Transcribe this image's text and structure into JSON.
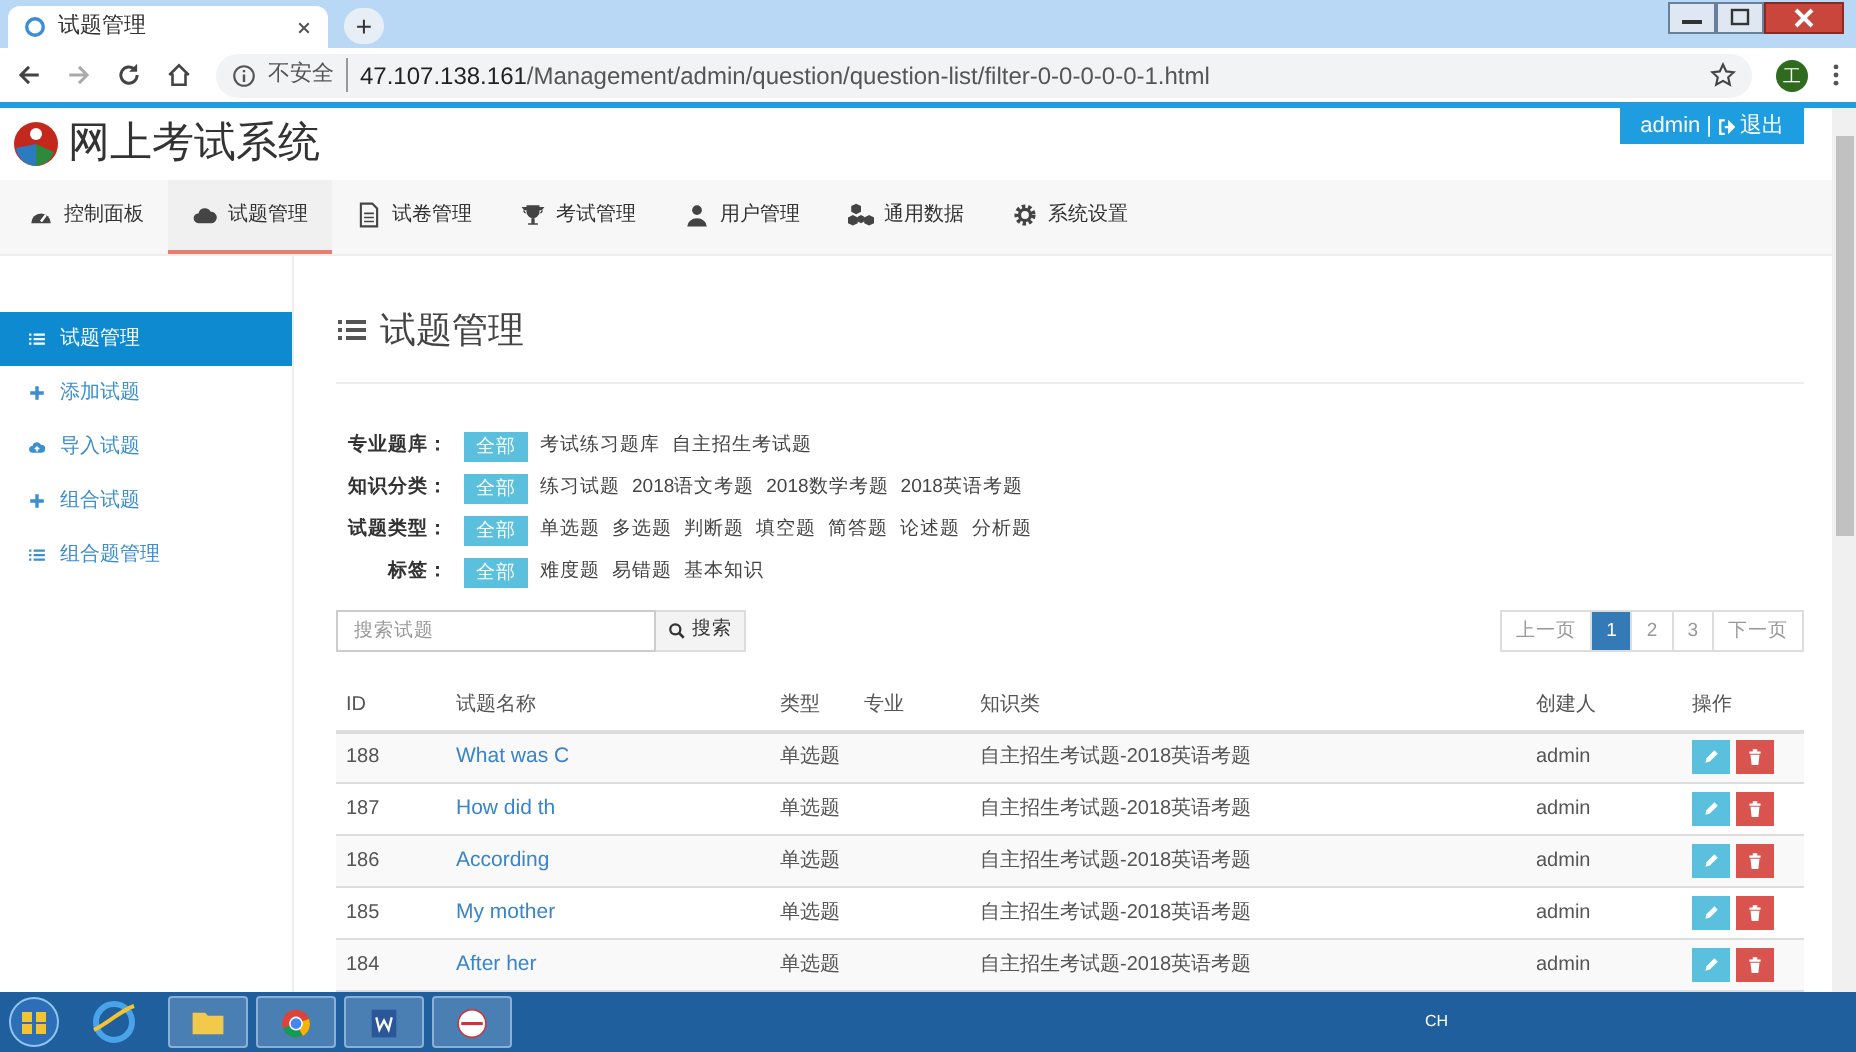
{
  "browser": {
    "tab_title": "试题管理",
    "new_tab": "+",
    "security": "不安全",
    "url_host": "47.107.138.161",
    "url_path": "/Management/admin/question/question-list/filter-0-0-0-0-0-1.html",
    "profile": "工"
  },
  "header": {
    "site_title": "网上考试系统",
    "user": "admin",
    "separator": "|",
    "logout": "退出"
  },
  "nav": [
    {
      "label": "控制面板",
      "selected": false
    },
    {
      "label": "试题管理",
      "selected": true
    },
    {
      "label": "试卷管理",
      "selected": false
    },
    {
      "label": "考试管理",
      "selected": false
    },
    {
      "label": "用户管理",
      "selected": false
    },
    {
      "label": "通用数据",
      "selected": false
    },
    {
      "label": "系统设置",
      "selected": false
    }
  ],
  "sidebar": [
    {
      "label": "试题管理",
      "selected": true
    },
    {
      "label": "添加试题",
      "selected": false
    },
    {
      "label": "导入试题",
      "selected": false
    },
    {
      "label": "组合试题",
      "selected": false
    },
    {
      "label": "组合题管理",
      "selected": false
    }
  ],
  "page_title": "试题管理",
  "filters": [
    {
      "label": "专业题库：",
      "options": [
        {
          "label": "全部",
          "selected": true
        },
        {
          "label": "考试练习题库",
          "selected": false
        },
        {
          "label": "自主招生考试题",
          "selected": false
        }
      ]
    },
    {
      "label": "知识分类：",
      "options": [
        {
          "label": "全部",
          "selected": true
        },
        {
          "label": "练习试题",
          "selected": false
        },
        {
          "label": "2018语文考题",
          "selected": false
        },
        {
          "label": "2018数学考题",
          "selected": false
        },
        {
          "label": "2018英语考题",
          "selected": false
        }
      ]
    },
    {
      "label": "试题类型：",
      "options": [
        {
          "label": "全部",
          "selected": true
        },
        {
          "label": "单选题",
          "selected": false
        },
        {
          "label": "多选题",
          "selected": false
        },
        {
          "label": "判断题",
          "selected": false
        },
        {
          "label": "填空题",
          "selected": false
        },
        {
          "label": "简答题",
          "selected": false
        },
        {
          "label": "论述题",
          "selected": false
        },
        {
          "label": "分析题",
          "selected": false
        }
      ]
    },
    {
      "label": "标签：",
      "options": [
        {
          "label": "全部",
          "selected": true
        },
        {
          "label": "难度题",
          "selected": false
        },
        {
          "label": "易错题",
          "selected": false
        },
        {
          "label": "基本知识",
          "selected": false
        }
      ]
    }
  ],
  "search": {
    "placeholder": "搜索试题",
    "button": "搜索"
  },
  "pagination": [
    {
      "label": "上一页",
      "selected": false
    },
    {
      "label": "1",
      "selected": true
    },
    {
      "label": "2",
      "selected": false
    },
    {
      "label": "3",
      "selected": false
    },
    {
      "label": "下一页",
      "selected": false
    }
  ],
  "table": {
    "columns": [
      "ID",
      "试题名称",
      "类型",
      "专业",
      "知识类",
      "创建人",
      "操作"
    ],
    "rows": [
      {
        "id": "188",
        "name": "What was C",
        "type": "单选题",
        "knowledge": "自主招生考试题-2018英语考题",
        "creator": "admin"
      },
      {
        "id": "187",
        "name": "How did th",
        "type": "单选题",
        "knowledge": "自主招生考试题-2018英语考题",
        "creator": "admin"
      },
      {
        "id": "186",
        "name": "According",
        "type": "单选题",
        "knowledge": "自主招生考试题-2018英语考题",
        "creator": "admin"
      },
      {
        "id": "185",
        "name": "My mother",
        "type": "单选题",
        "knowledge": "自主招生考试题-2018英语考题",
        "creator": "admin"
      },
      {
        "id": "184",
        "name": "After her",
        "type": "单选题",
        "knowledge": "自主招生考试题-2018英语考题",
        "creator": "admin"
      }
    ]
  },
  "taskbar": {
    "tray_lang": "CH"
  }
}
